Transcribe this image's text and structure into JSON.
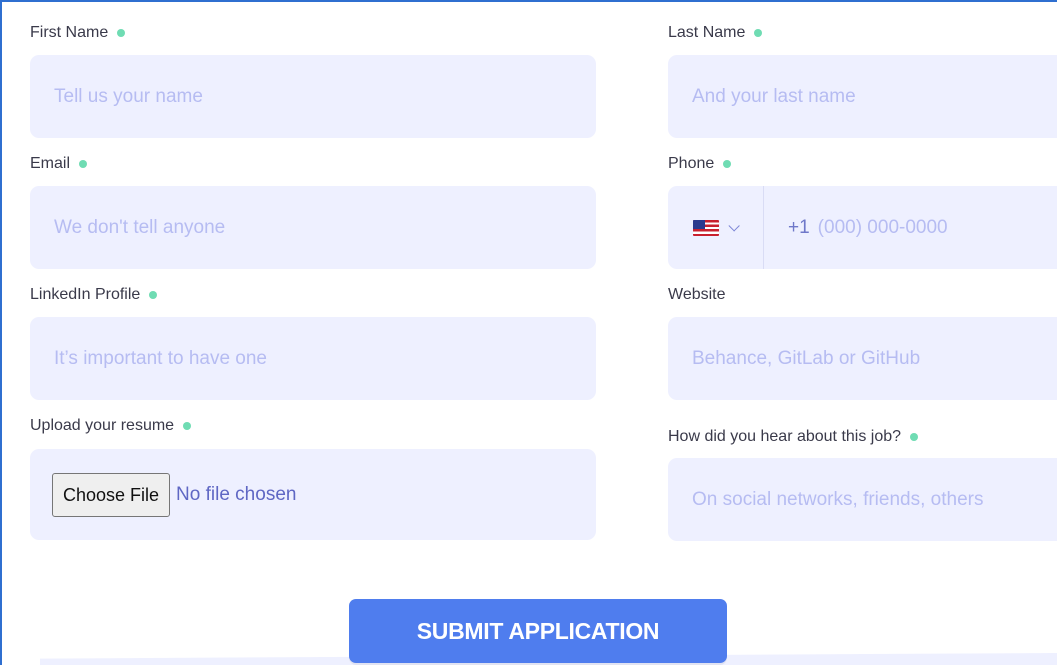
{
  "form": {
    "first_name": {
      "label": "First Name",
      "placeholder": "Tell us your name"
    },
    "last_name": {
      "label": "Last Name",
      "placeholder": "And your last name"
    },
    "email": {
      "label": "Email",
      "placeholder": "We don't tell anyone"
    },
    "phone": {
      "label": "Phone",
      "country_flag": "us-flag-icon",
      "prefix": "+1",
      "placeholder": "(000) 000-0000"
    },
    "linkedin": {
      "label": "LinkedIn Profile",
      "placeholder": "It’s important to have one"
    },
    "website": {
      "label": "Website",
      "placeholder": "Behance, GitLab or GitHub"
    },
    "resume": {
      "label": "Upload your resume",
      "button_label": "Choose File",
      "status": "No file chosen"
    },
    "source": {
      "label": "How did you hear about this job?",
      "placeholder": "On social networks, friends, others"
    },
    "submit_label": "SUBMIT APPLICATION"
  },
  "colors": {
    "accent": "#4f7dee",
    "field_bg": "#eef0ff",
    "required_dot": "#6fdcb3",
    "frame_border": "#2f6fd0"
  }
}
